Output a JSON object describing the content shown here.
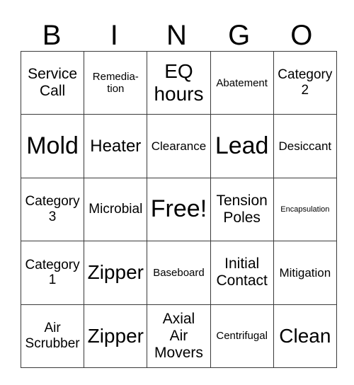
{
  "header": {
    "letters": [
      "B",
      "I",
      "N",
      "G",
      "O"
    ]
  },
  "grid": {
    "rows": [
      [
        "Service Call",
        "Remedia- tion",
        "EQ hours",
        "Abatement",
        "Category 2"
      ],
      [
        "Mold",
        "Heater",
        "Clearance",
        "Lead",
        "Desiccant"
      ],
      [
        "Category 3",
        "Microbial",
        "Free!",
        "Tension Poles",
        "Encapsulation"
      ],
      [
        "Category 1",
        "Zipper",
        "Baseboard",
        "Initial Contact",
        "Mitigation"
      ],
      [
        "Air Scrubber",
        "Zipper",
        "Axial Air Movers",
        "Centrifugal",
        "Clean"
      ]
    ]
  },
  "cells": {
    "r0": [
      [
        "Service",
        "Call"
      ],
      [
        "Remedia-",
        "tion"
      ],
      [
        "EQ",
        "hours"
      ],
      [
        "Abatement"
      ],
      [
        "Category",
        "2"
      ]
    ],
    "r1": [
      [
        "Mold"
      ],
      [
        "Heater"
      ],
      [
        "Clearance"
      ],
      [
        "Lead"
      ],
      [
        "Desiccant"
      ]
    ],
    "r2": [
      [
        "Category",
        "3"
      ],
      [
        "Microbial"
      ],
      [
        "Free!"
      ],
      [
        "Tension",
        "Poles"
      ],
      [
        "Encapsulation"
      ]
    ],
    "r3": [
      [
        "Category",
        "1"
      ],
      [
        "Zipper"
      ],
      [
        "Baseboard"
      ],
      [
        "Initial",
        "Contact"
      ],
      [
        "Mitigation"
      ]
    ],
    "r4": [
      [
        "Air",
        "Scrubber"
      ],
      [
        "Zipper"
      ],
      [
        "Axial",
        "Air",
        "Movers"
      ],
      [
        "Centrifugal"
      ],
      [
        "Clean"
      ]
    ]
  },
  "colors": {
    "border": "#3a3a3a",
    "text": "#000000",
    "background": "#ffffff"
  }
}
